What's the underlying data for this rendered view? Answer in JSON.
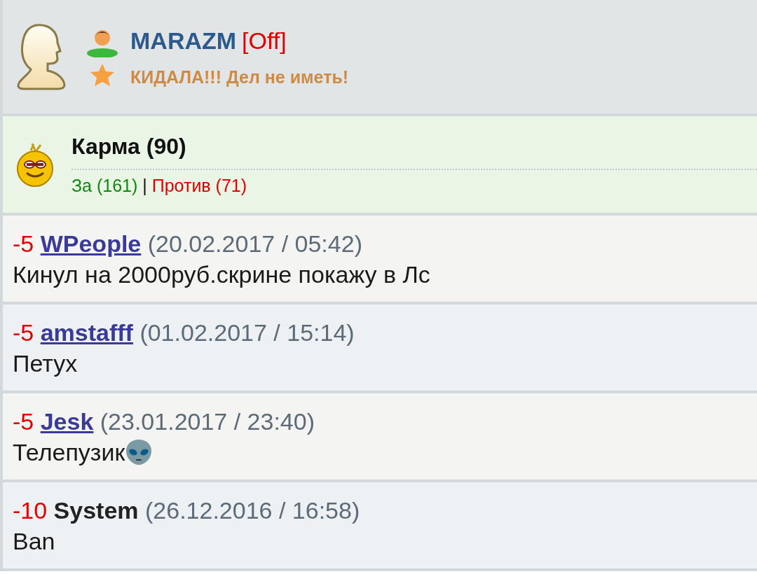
{
  "profile": {
    "name": "MARAZM",
    "status": "[Off]",
    "title": "КИДАЛА!!! Дел не иметь!"
  },
  "karma": {
    "heading": "Карма (90)",
    "for": "За (161)",
    "separator": "|",
    "against": "Против (71)"
  },
  "entries": [
    {
      "kind": "user",
      "score": "-5",
      "author": "WPeople",
      "date": "(20.02.2017 / 05:42)",
      "text": "Кинул на 2000руб.скрине покажу в Лс",
      "trailing_emoji": false
    },
    {
      "kind": "user",
      "score": "-5",
      "author": "amstafff",
      "date": "(01.02.2017 / 15:14)",
      "text": "Петух",
      "trailing_emoji": false
    },
    {
      "kind": "user",
      "score": "-5",
      "author": "Jesk",
      "date": "(23.01.2017 / 23:40)",
      "text": "Телепузик",
      "trailing_emoji": true
    },
    {
      "kind": "system",
      "score": "-10",
      "author": "System",
      "date": "(26.12.2016 / 16:58)",
      "text": "Ban",
      "trailing_emoji": false
    }
  ]
}
